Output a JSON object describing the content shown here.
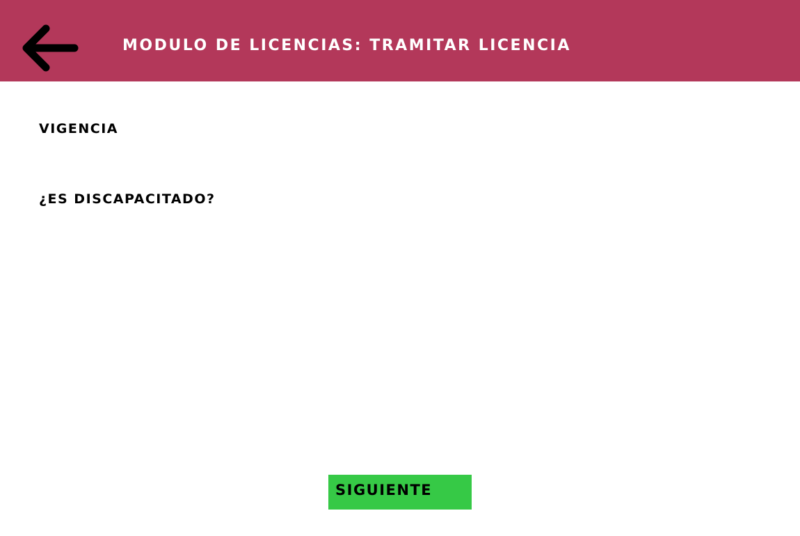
{
  "header": {
    "back_icon": "arrow-left-icon",
    "title": "MODULO DE LICENCIAS: TRAMITAR LICENCIA",
    "background_color": "#b3385a",
    "title_color": "#ffffff"
  },
  "form": {
    "vigencia_label": "VIGENCIA",
    "discapacitado_label": "¿ES DISCAPACITADO?"
  },
  "actions": {
    "next_label": "SIGUIENTE",
    "next_color": "#36c946"
  }
}
